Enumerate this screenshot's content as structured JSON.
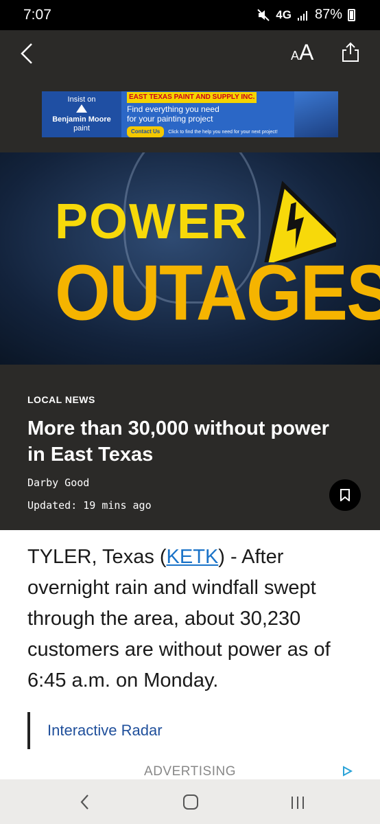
{
  "status_bar": {
    "time": "7:07",
    "network": "4G",
    "battery": "87%"
  },
  "header": {
    "font_size_small": "A",
    "font_size_large": "A"
  },
  "ad_banner": {
    "left_line1": "Insist on",
    "left_brand": "Benjamin Moore",
    "left_line3": "paint",
    "company": "EAST TEXAS PAINT AND SUPPLY INC.",
    "tagline_line1": "Find everything you need",
    "tagline_line2": "for your painting project",
    "contact": "Contact Us",
    "small_text": "Click to find the help you need for your next project!"
  },
  "hero": {
    "line1": "POWER",
    "line2": "OUTAGES"
  },
  "article": {
    "section": "LOCAL NEWS",
    "headline": "More than 30,000 without power in East Texas",
    "author": "Darby Good",
    "updated": "Updated: 19 mins ago",
    "lead_prefix": "TYLER, Texas (",
    "lead_link": "KETK",
    "lead_suffix": ") - After overnight rain and windfall swept through the area, about 30,230 customers are without power as of 6:45 a.m. on Monday.",
    "related_link": "Interactive Radar",
    "ad_label": "ADVERTISING"
  },
  "colors": {
    "header_bg": "#2b2a28",
    "hero_yellow": "#f7d90a",
    "hero_orange": "#f5b400",
    "link_blue": "#1a73c8",
    "related_blue": "#1f4f9b"
  }
}
